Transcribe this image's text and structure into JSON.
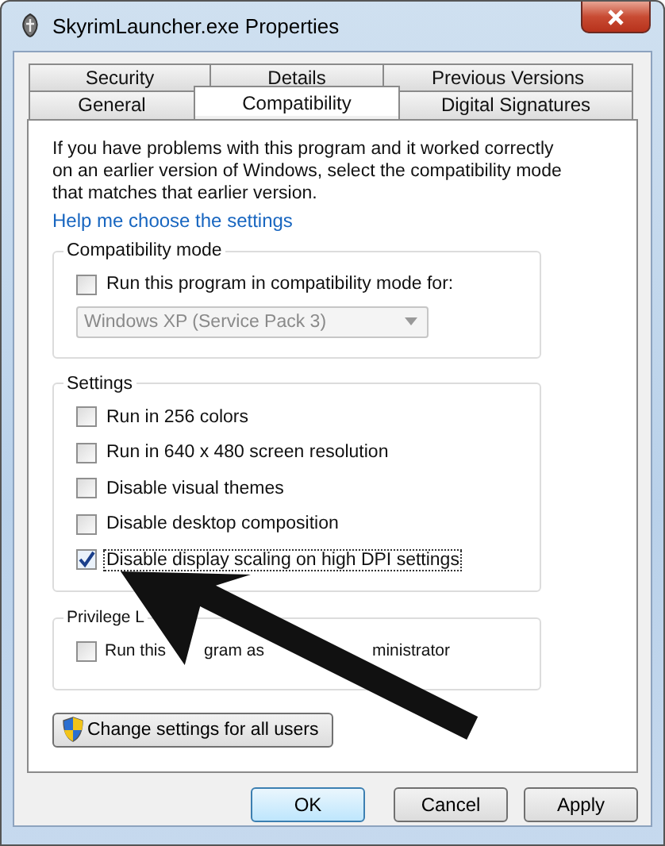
{
  "window": {
    "title": "SkyrimLauncher.exe Properties"
  },
  "tab_rows": [
    {
      "tabs": [
        {
          "label": "Security",
          "selected": false
        },
        {
          "label": "Details",
          "selected": false
        },
        {
          "label": "Previous Versions",
          "selected": false
        }
      ]
    },
    {
      "tabs": [
        {
          "label": "General",
          "selected": false
        },
        {
          "label": "Compatibility",
          "selected": true
        },
        {
          "label": "Digital Signatures",
          "selected": false
        }
      ]
    }
  ],
  "intro": "If you have problems with this program and it worked correctly on an earlier version of Windows, select the compatibility mode that matches that earlier version.",
  "help_link": "Help me choose the settings",
  "groups": [
    {
      "title": "Compatibility mode",
      "checkboxes": [
        {
          "label": "Run this program in compatibility mode for:",
          "checked": false,
          "focused": false
        }
      ],
      "dropdown": {
        "value": "Windows XP (Service Pack 3)",
        "disabled": true
      }
    },
    {
      "title": "Settings",
      "checkboxes": [
        {
          "label": "Run in 256 colors",
          "checked": false,
          "focused": false
        },
        {
          "label": "Run in 640 x 480 screen resolution",
          "checked": false,
          "focused": false
        },
        {
          "label": "Disable visual themes",
          "checked": false,
          "focused": false
        },
        {
          "label": "Disable desktop composition",
          "checked": false,
          "focused": false
        },
        {
          "label": "Disable display scaling on high DPI settings",
          "checked": true,
          "focused": true
        }
      ]
    },
    {
      "title": "Privilege L",
      "checkboxes": [
        {
          "label_parts": [
            "Run this",
            "gram as",
            "ministrator"
          ],
          "checked": false,
          "focused": false
        }
      ]
    }
  ],
  "shield_button": "Change settings for all users",
  "buttons": [
    {
      "label": "OK",
      "default": true
    },
    {
      "label": "Cancel",
      "default": false
    },
    {
      "label": "Apply",
      "default": false
    }
  ]
}
